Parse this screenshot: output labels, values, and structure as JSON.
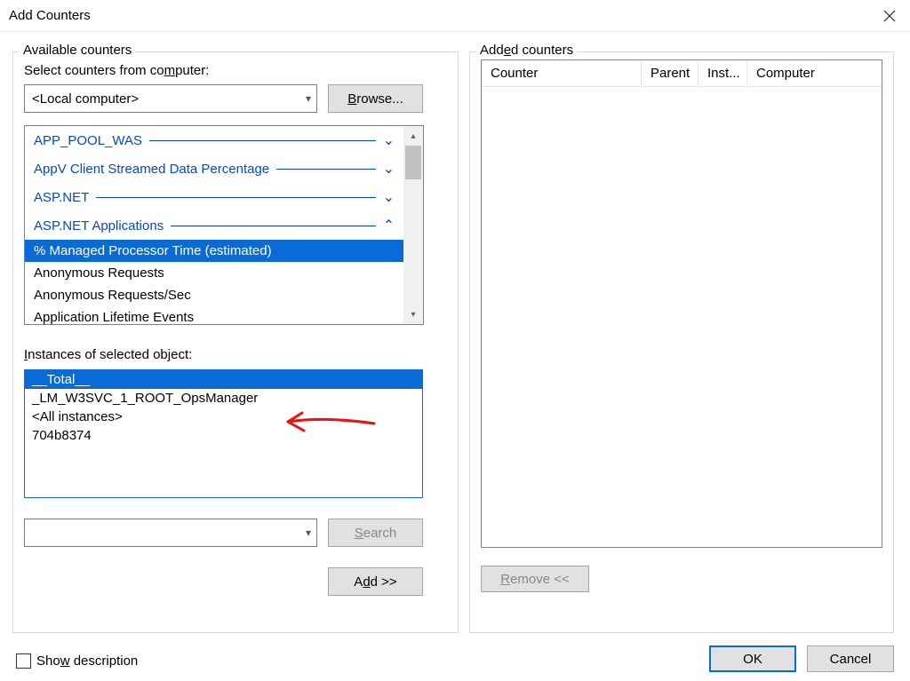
{
  "window": {
    "title": "Add Counters"
  },
  "left": {
    "group_label": "Available counters",
    "select_label_pre": "Select counters from co",
    "select_label_u": "m",
    "select_label_post": "puter:",
    "computer_value": "<Local computer>",
    "browse_pre": "",
    "browse_u": "B",
    "browse_post": "rowse...",
    "categories": [
      {
        "label": "APP_POOL_WAS",
        "expanded": false
      },
      {
        "label": "AppV Client Streamed Data Percentage",
        "expanded": false
      },
      {
        "label": "ASP.NET",
        "expanded": false
      },
      {
        "label": "ASP.NET Applications",
        "expanded": true
      }
    ],
    "items": [
      {
        "label": "% Managed Processor Time (estimated)",
        "selected": true
      },
      {
        "label": "Anonymous Requests",
        "selected": false
      },
      {
        "label": "Anonymous Requests/Sec",
        "selected": false
      },
      {
        "label": "Application Lifetime Events",
        "selected": false
      }
    ],
    "instances_label_u": "I",
    "instances_label_post": "nstances of selected object:",
    "instances": [
      {
        "label": "__Total__",
        "selected": true
      },
      {
        "label": "_LM_W3SVC_1_ROOT_OpsManager",
        "selected": false
      },
      {
        "label": "<All instances>",
        "selected": false
      },
      {
        "label": "704b8374",
        "selected": false
      }
    ],
    "search_u": "S",
    "search_post": "earch",
    "add_pre": "A",
    "add_u": "d",
    "add_post": "d >>"
  },
  "right": {
    "group_label_pre": "Add",
    "group_label_u": "e",
    "group_label_post": "d counters",
    "columns": {
      "c1": "Counter",
      "c2": "Parent",
      "c3": "Inst...",
      "c4": "Computer"
    },
    "remove_u": "R",
    "remove_post": "emove <<"
  },
  "footer": {
    "show_desc_pre": "Sho",
    "show_desc_u": "w",
    "show_desc_post": " description",
    "ok": "OK",
    "cancel": "Cancel"
  }
}
